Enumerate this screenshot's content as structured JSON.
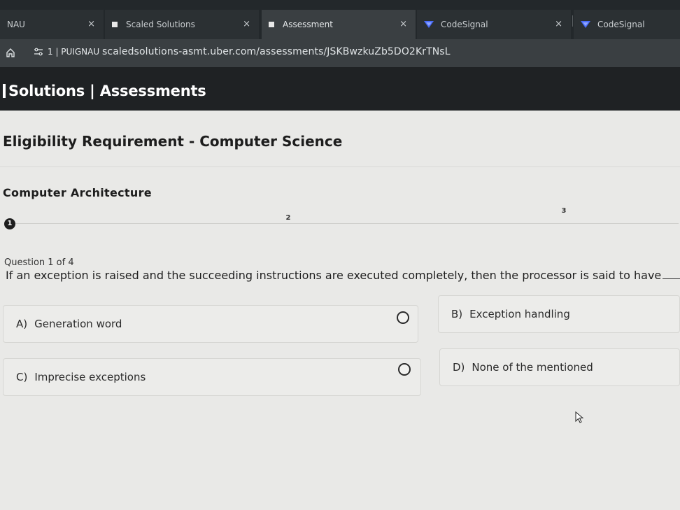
{
  "browser": {
    "tabs": [
      {
        "label": "NAU",
        "close": "×"
      },
      {
        "label": "Scaled Solutions",
        "close": "×"
      },
      {
        "label": "Assessment",
        "close": "×"
      },
      {
        "label": "CodeSignal",
        "close": "×"
      },
      {
        "label": "CodeSignal",
        "close": ""
      }
    ],
    "site_chip": "1 | PUIGNAU",
    "url": "scaledsolutions-asmt.uber.com/assessments/JSKBwzkuZb5DO2KrTNsL"
  },
  "header": {
    "title": "Solutions | Assessments"
  },
  "section": {
    "title": "Eligibility Requirement - Computer Science"
  },
  "subsection": {
    "title": "Computer Architecture"
  },
  "stepper": {
    "steps": [
      "1",
      "2",
      "3"
    ],
    "current": 1
  },
  "question": {
    "counter": "Question 1 of 4",
    "text": "If an exception is raised and the succeeding instructions are executed completely, then the processor is said to have"
  },
  "options": [
    {
      "letter": "A)",
      "text": "Generation word"
    },
    {
      "letter": "B)",
      "text": "Exception handling"
    },
    {
      "letter": "C)",
      "text": "Imprecise exceptions"
    },
    {
      "letter": "D)",
      "text": "None of the mentioned"
    }
  ],
  "colors": {
    "header_bg": "#1f2224",
    "page_bg": "#e9e9e7",
    "codesignal_blue": "#4a6cf7"
  }
}
